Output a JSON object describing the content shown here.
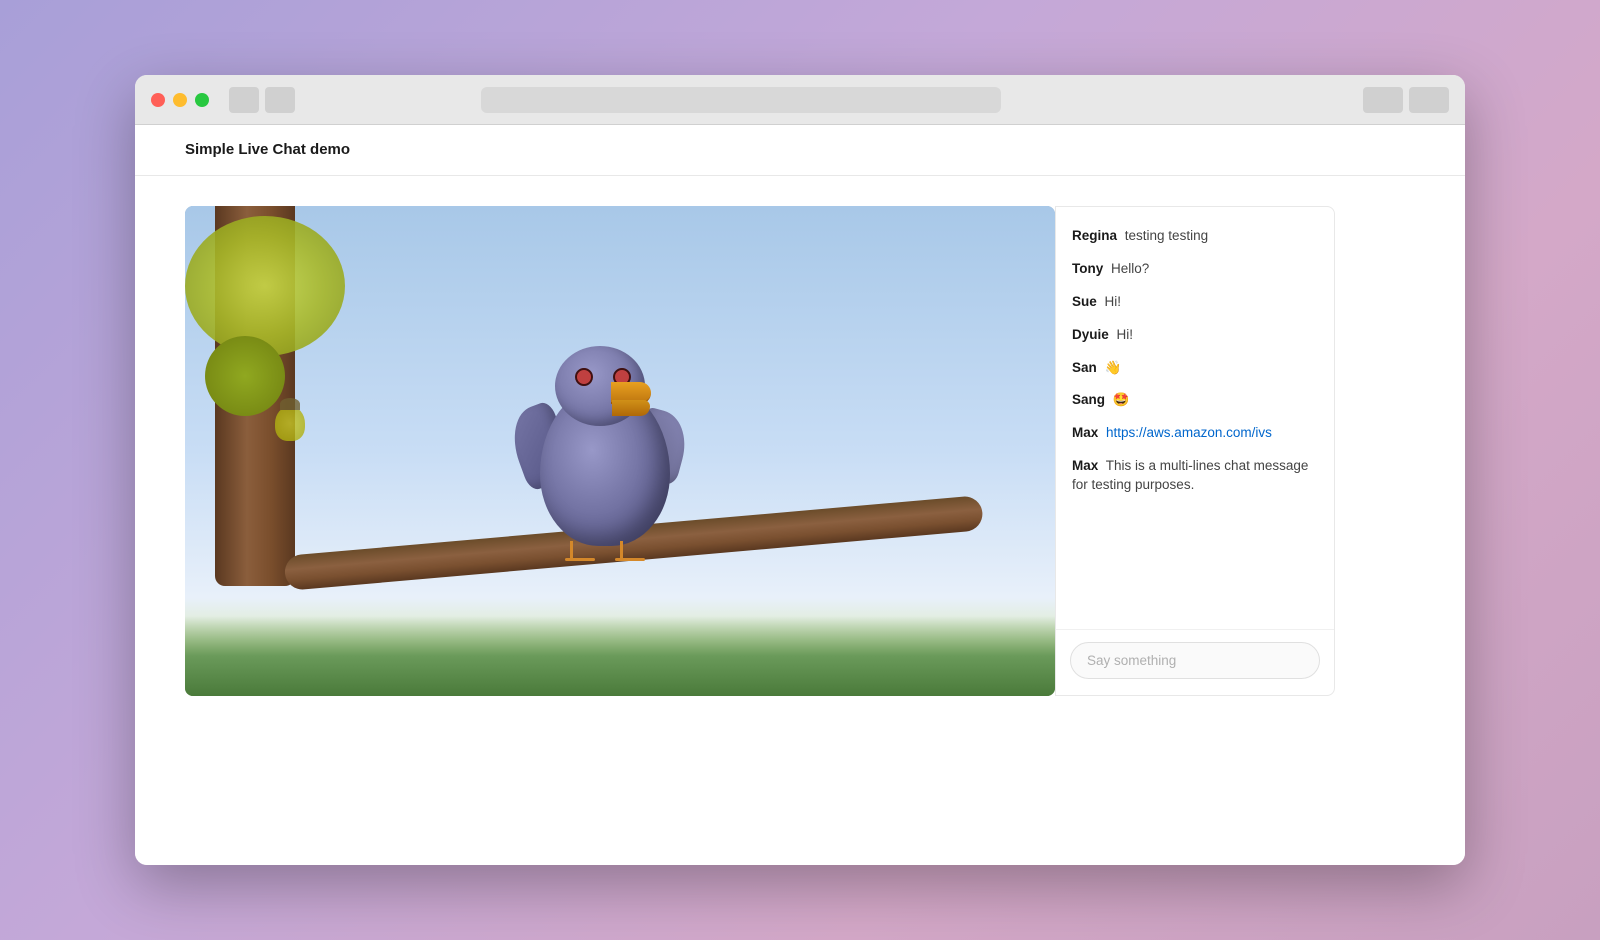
{
  "browser": {
    "address_bar_placeholder": "",
    "tab_label": "Simple Live Chat demo"
  },
  "page": {
    "title": "Simple Live Chat demo"
  },
  "chat": {
    "messages": [
      {
        "username": "Regina",
        "text": "testing testing",
        "type": "text"
      },
      {
        "username": "Tony",
        "text": "Hello?",
        "type": "text"
      },
      {
        "username": "Sue",
        "text": "Hi!",
        "type": "text"
      },
      {
        "username": "Dyuie",
        "text": "Hi!",
        "type": "text"
      },
      {
        "username": "San",
        "text": "👋",
        "type": "text"
      },
      {
        "username": "Sang",
        "text": "🤩",
        "type": "text"
      },
      {
        "username": "Max",
        "text": "https://aws.amazon.com/ivs",
        "type": "link",
        "link": "https://aws.amazon.com/ivs"
      },
      {
        "username": "Max",
        "text": "This is a multi-lines chat message for testing purposes.",
        "type": "text"
      }
    ],
    "input_placeholder": "Say something"
  }
}
